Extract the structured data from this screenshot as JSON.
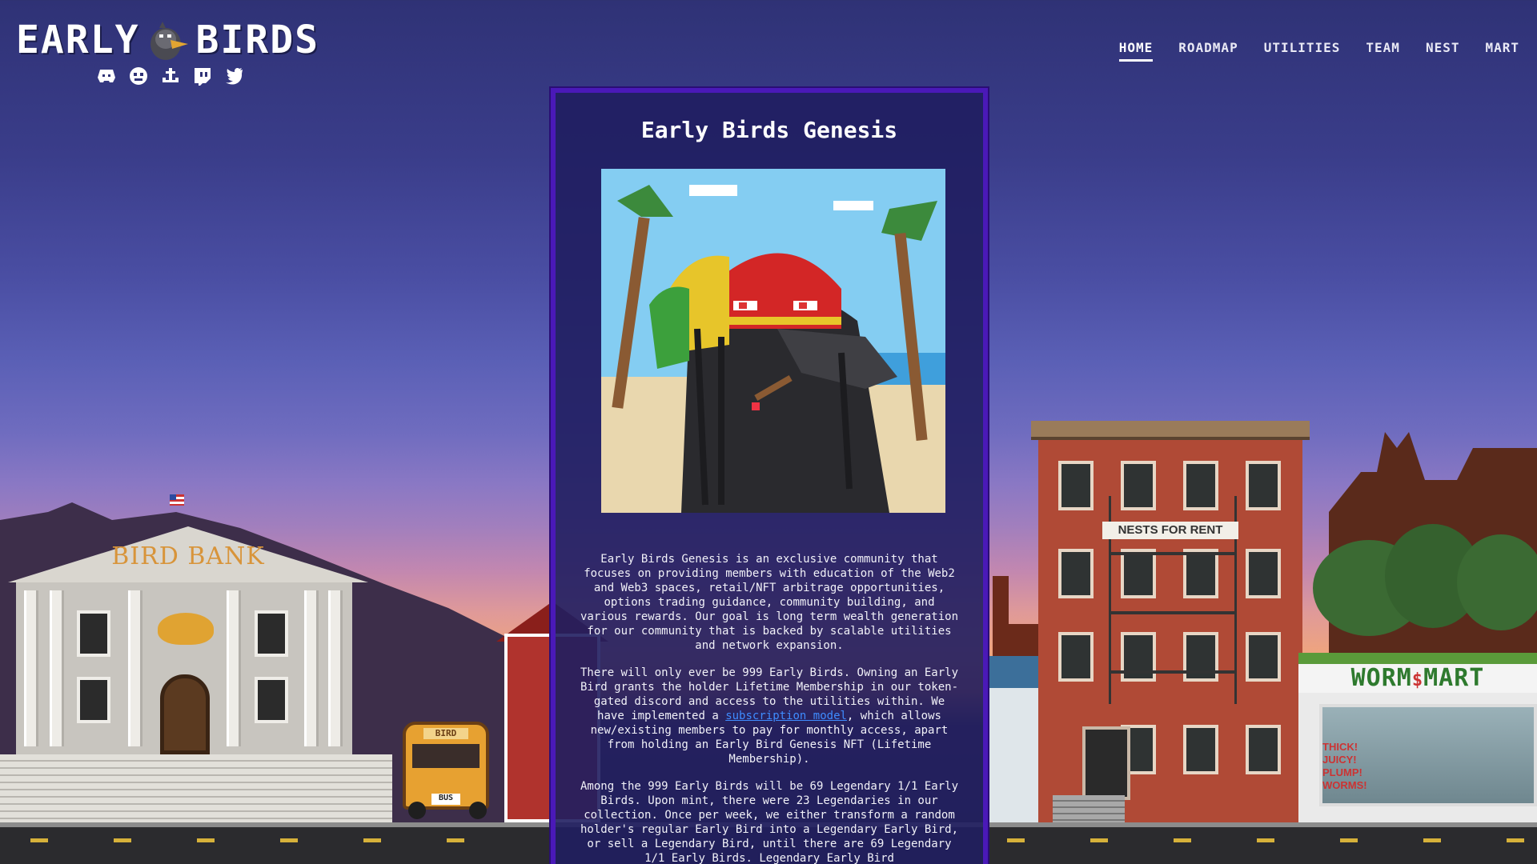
{
  "brand": {
    "logo_left": "EARLY",
    "logo_right": "BIRDS"
  },
  "socials": [
    {
      "icon": "discord-icon"
    },
    {
      "icon": "opensea-icon"
    },
    {
      "icon": "anchor-icon"
    },
    {
      "icon": "twitch-icon"
    },
    {
      "icon": "twitter-icon"
    }
  ],
  "nav": {
    "home": "HOME",
    "roadmap": "ROADMAP",
    "utilities": "UTILITIES",
    "team": "TEAM",
    "nest": "NEST",
    "mart": "MART",
    "active": "HOME"
  },
  "card": {
    "title": "Early Birds Genesis",
    "p1": "Early Birds Genesis is an exclusive community that focuses on providing members with education of the Web2 and Web3 spaces, retail/NFT arbitrage opportunities, options trading guidance, community building, and various rewards. Our goal is long term wealth generation for our community that is backed by scalable utilities and network expansion.",
    "p2_before": "There will only ever be 999 Early Birds. Owning an Early Bird grants the holder Lifetime Membership in our token-gated discord and access to the utilities within. We have implemented a ",
    "p2_link": "subscription model",
    "p2_after": ", which allows new/existing members to pay for monthly access, apart from holding an Early Bird Genesis NFT (Lifetime Membership).",
    "p3": "Among the 999 Early Birds will be 69 Legendary 1/1 Early Birds. Upon mint, there were 23 Legendaries in our collection. Once per week, we either transform a random holder's regular Early Bird into a Legendary Early Bird, or sell a Legendary Bird, until there are 69 Legendary 1/1 Early Birds. Legendary Early Bird"
  },
  "scene": {
    "bank_sign": "BIRD BANK",
    "bus_sign": "BIRD",
    "bus_plate": "BUS",
    "nest_sign": "NESTS FOR RENT",
    "mart_sign_left": "WORM",
    "mart_sign_mid": "$",
    "mart_sign_right": "MART",
    "mart_window_1": "THICK!",
    "mart_window_2": "JUICY!",
    "mart_window_3": "PLUMP!",
    "mart_window_4": "WORMS!",
    "colors": {
      "card_border": "#4a19b8",
      "link": "#3f8cff",
      "mart_green": "#2e7a2e"
    }
  }
}
